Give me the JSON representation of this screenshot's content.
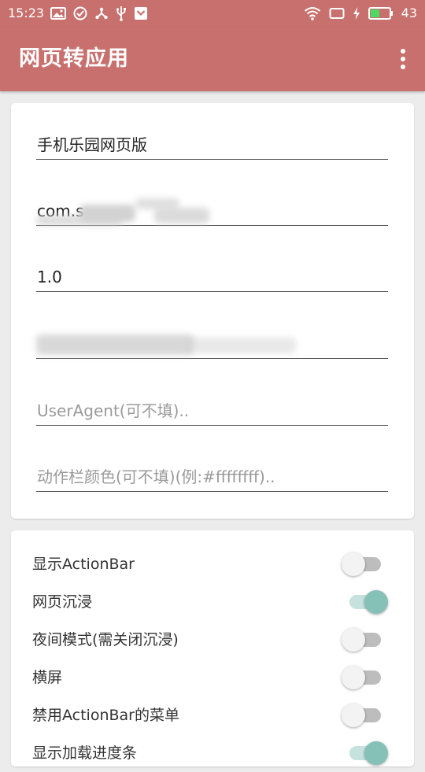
{
  "status_bar": {
    "time": "15:23",
    "battery": "43",
    "left_icons": [
      "image-icon",
      "check-circle-icon",
      "share-icon",
      "usb-icon",
      "download-icon"
    ],
    "right_icons": [
      "wifi-icon",
      "screen-icon",
      "charging-icon",
      "battery-icon"
    ]
  },
  "app_bar": {
    "title": "网页转应用",
    "menu_icon": "more-vert-icon"
  },
  "form": {
    "app_name": {
      "value": "手机乐园网页版",
      "placeholder": ""
    },
    "package_name": {
      "value": "com.s",
      "placeholder": ""
    },
    "version": {
      "value": "1.0",
      "placeholder": ""
    },
    "url": {
      "value": "",
      "placeholder": ""
    },
    "user_agent": {
      "value": "",
      "placeholder": "UserAgent(可不填).."
    },
    "action_bar_color": {
      "value": "",
      "placeholder": "动作栏颜色(可不填)(例:#ffffffff).."
    }
  },
  "switches": [
    {
      "label": "显示ActionBar",
      "checked": false
    },
    {
      "label": "网页沉浸",
      "checked": true
    },
    {
      "label": "夜间模式(需关闭沉浸)",
      "checked": false
    },
    {
      "label": "横屏",
      "checked": false
    },
    {
      "label": "禁用ActionBar的菜单",
      "checked": false
    },
    {
      "label": "显示加载进度条",
      "checked": true
    }
  ],
  "colors": {
    "primary": "#c8706d",
    "switch_on_thumb": "#86c1b8",
    "switch_on_track": "#c6e2de",
    "switch_off_thumb": "#f3f3f3",
    "switch_off_track": "#bdbdbd",
    "background": "#ececec"
  }
}
